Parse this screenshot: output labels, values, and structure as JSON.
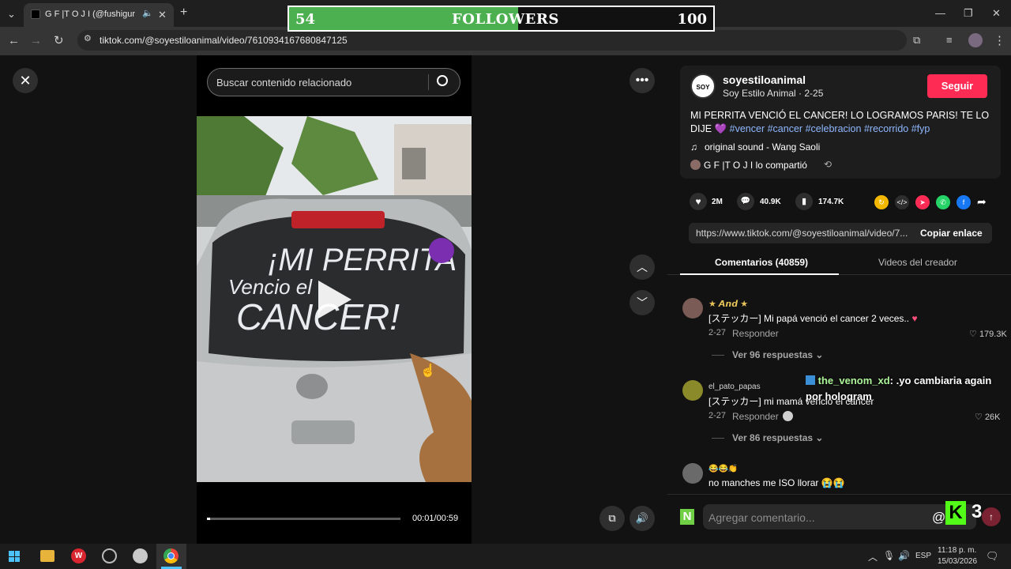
{
  "browser": {
    "tab_title": "G F |T O J I (@fushigur",
    "new_tab": "+",
    "url": "tiktok.com/@soyestiloanimal/video/7610934167680847125"
  },
  "overlay": {
    "left_value": "54",
    "label": "FOLLOWERS",
    "right_value": "100",
    "progress": 0.54,
    "fill_color": "#4caf50"
  },
  "search": {
    "placeholder": "Buscar contenido relacionado"
  },
  "video": {
    "time": "00:01/00:59",
    "progress": 0.017
  },
  "author": {
    "handle": "soyestiloanimal",
    "avatar_text": "SOY",
    "subtitle": "Soy Estilo Animal · 2-25",
    "follow_label": "Seguir",
    "follow_color": "#fe2c55"
  },
  "caption": {
    "text": "MI PERRITA VENCIÓ EL CANCER! LO LOGRAMOS PARIS! TE LO DIJE",
    "emoji": "💜",
    "hashtags": [
      "#vencer",
      "#cancer",
      "#celebracion",
      "#recorrido",
      "#fyp"
    ]
  },
  "sound": {
    "icon": "♫",
    "text": "original sound - Wang Saoli"
  },
  "shared": {
    "text": "G F |T O J I  lo compartió"
  },
  "stats": {
    "likes": "2M",
    "comments": "40.9K",
    "saves": "174.7K"
  },
  "share_link": {
    "url": "https://www.tiktok.com/@soyestiloanimal/video/7...",
    "copy_label": "Copiar enlace"
  },
  "tabs": {
    "comments": "Comentarios (40859)",
    "creator": "Videos del creador"
  },
  "comments": [
    {
      "user": "★ 𝘼𝙣𝙙 ★",
      "text": "[ステッカー] Mi papá venció el cancer 2 veces..",
      "date": "2-27",
      "reply": "Responder",
      "likes": "179.3K",
      "more": "Ver 96 respuestas"
    },
    {
      "user": "el_pato_papas",
      "text": "[ステッカー] mi mamá venció el cancer",
      "date": "2-27",
      "reply": "Responder",
      "likes": "26K",
      "more": "Ver 86 respuestas"
    },
    {
      "user": "😂😂👏",
      "text": "no manches me ISO llorar 😭😭"
    }
  ],
  "stream_chat": {
    "user": "the_venom_xd",
    "message": ": .yo cambiaria again por hologram"
  },
  "comment_input": {
    "placeholder": "Agregar comentario...",
    "at": "@"
  },
  "stream_badge": {
    "letter": "K",
    "count": "3"
  },
  "taskbar": {
    "lang": "ESP",
    "time": "11:18 p. m.",
    "date": "15/03/2026"
  }
}
